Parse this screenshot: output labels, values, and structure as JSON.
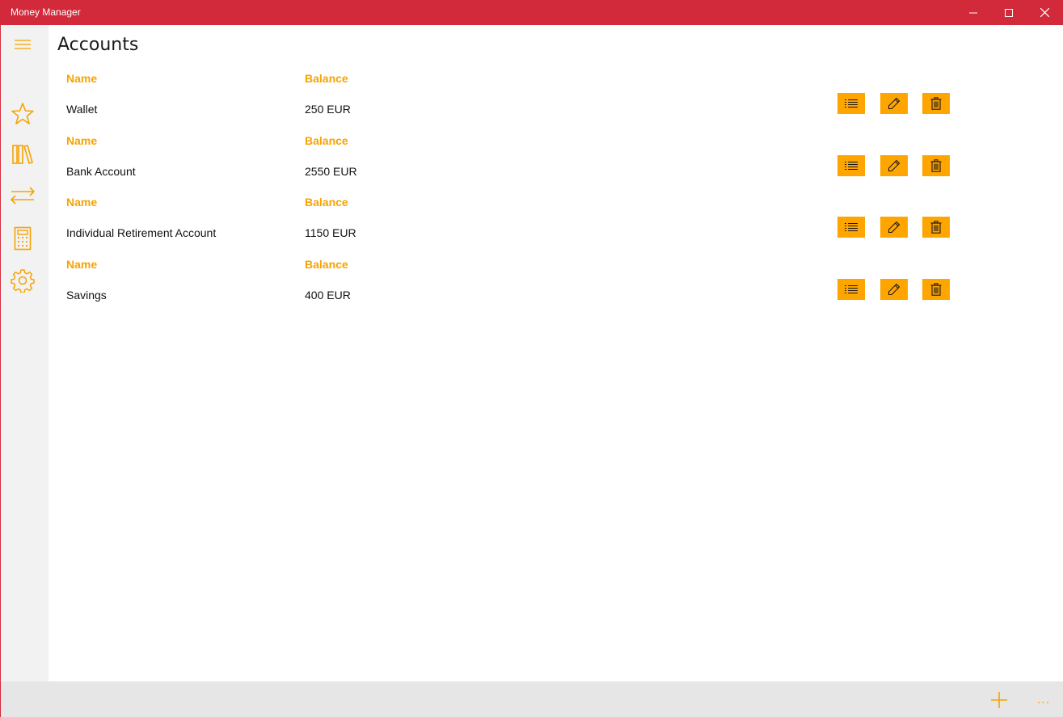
{
  "window": {
    "title": "Money Manager",
    "accent": "#d22a3b",
    "controls": [
      "minimize-icon",
      "maximize-icon",
      "close-icon"
    ]
  },
  "sidebar": {
    "items": [
      {
        "icon": "hamburger-icon"
      },
      {
        "icon": "star-icon"
      },
      {
        "icon": "books-icon"
      },
      {
        "icon": "transfer-arrows-icon"
      },
      {
        "icon": "calculator-icon"
      },
      {
        "icon": "gear-icon"
      }
    ],
    "icon_color": "#f7a300"
  },
  "page": {
    "title": "Accounts",
    "header_color": "#f7a300",
    "button_color": "#ffa500"
  },
  "accounts": [
    {
      "name_header": "Name",
      "balance_header": "Balance",
      "name": "Wallet",
      "balance": "250 EUR"
    },
    {
      "name_header": "Name",
      "balance_header": "Balance",
      "name": "Bank Account",
      "balance": "2550 EUR"
    },
    {
      "name_header": "Name",
      "balance_header": "Balance",
      "name": "Individual Retirement Account",
      "balance": "1150 EUR"
    },
    {
      "name_header": "Name",
      "balance_header": "Balance",
      "name": "Savings",
      "balance": "400 EUR"
    }
  ],
  "row_actions": [
    "list-icon",
    "pencil-icon",
    "trash-icon"
  ],
  "appbar": {
    "add_icon": "plus-icon",
    "more_label": "..."
  }
}
